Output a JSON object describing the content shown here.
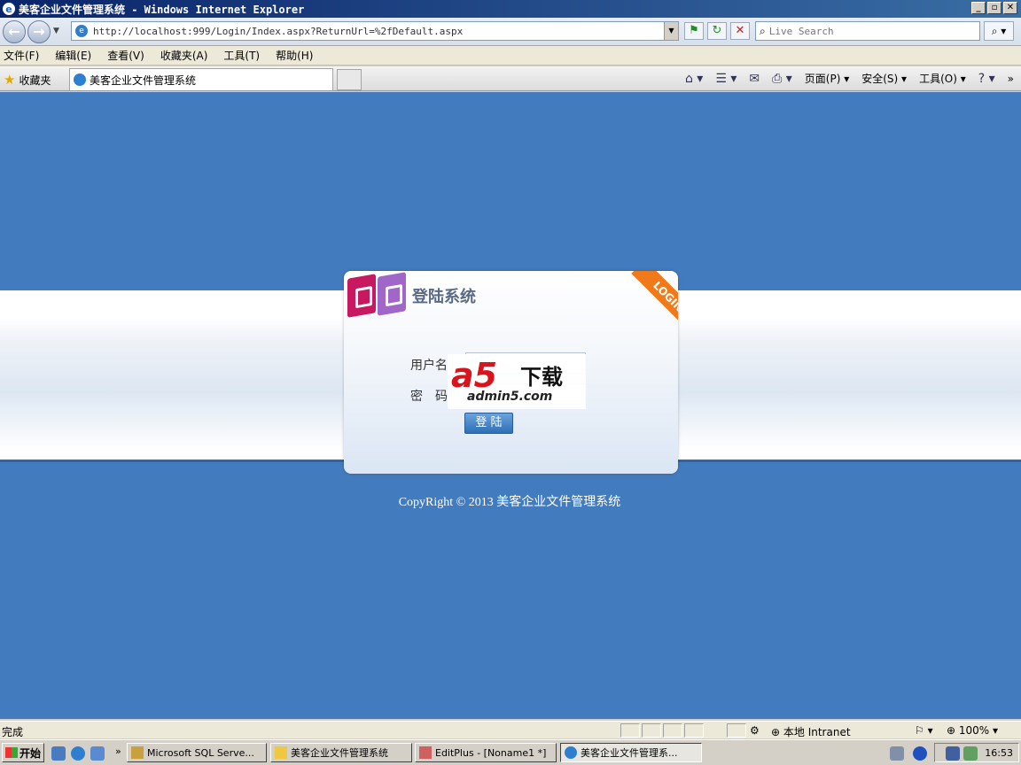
{
  "window": {
    "title": "美客企业文件管理系统 - Windows Internet Explorer",
    "minimize": "_",
    "restore": "▫",
    "close": "✕"
  },
  "address": {
    "url": "http://localhost:999/Login/Index.aspx?ReturnUrl=%2fDefault.aspx",
    "search_placeholder": "Live Search"
  },
  "menu": [
    "文件(F)",
    "编辑(E)",
    "查看(V)",
    "收藏夹(A)",
    "工具(T)",
    "帮助(H)"
  ],
  "tabs": {
    "favorites_label": "收藏夹",
    "active_tab": "美客企业文件管理系统"
  },
  "command_bar": {
    "page": "页面(P)",
    "safety": "安全(S)",
    "tools": "工具(O)"
  },
  "login": {
    "title": "登陆系统",
    "ribbon": "LOGIN",
    "username_label": "用户名",
    "password_label": "密　码",
    "button": "登 陆"
  },
  "watermark": {
    "main": "a5",
    "cn": "下载",
    "domain": "admin5.com"
  },
  "footer": {
    "copyright": "CopyRight © 2013 美客企业文件管理系统"
  },
  "status": {
    "text": "完成",
    "zone": "本地 Intranet",
    "zoom": "100%"
  },
  "taskbar": {
    "start": "开始",
    "items": [
      "Microsoft SQL Serve...",
      "美客企业文件管理系统",
      "EditPlus - [Noname1 *]",
      "美客企业文件管理系..."
    ],
    "clock": "16:53"
  }
}
